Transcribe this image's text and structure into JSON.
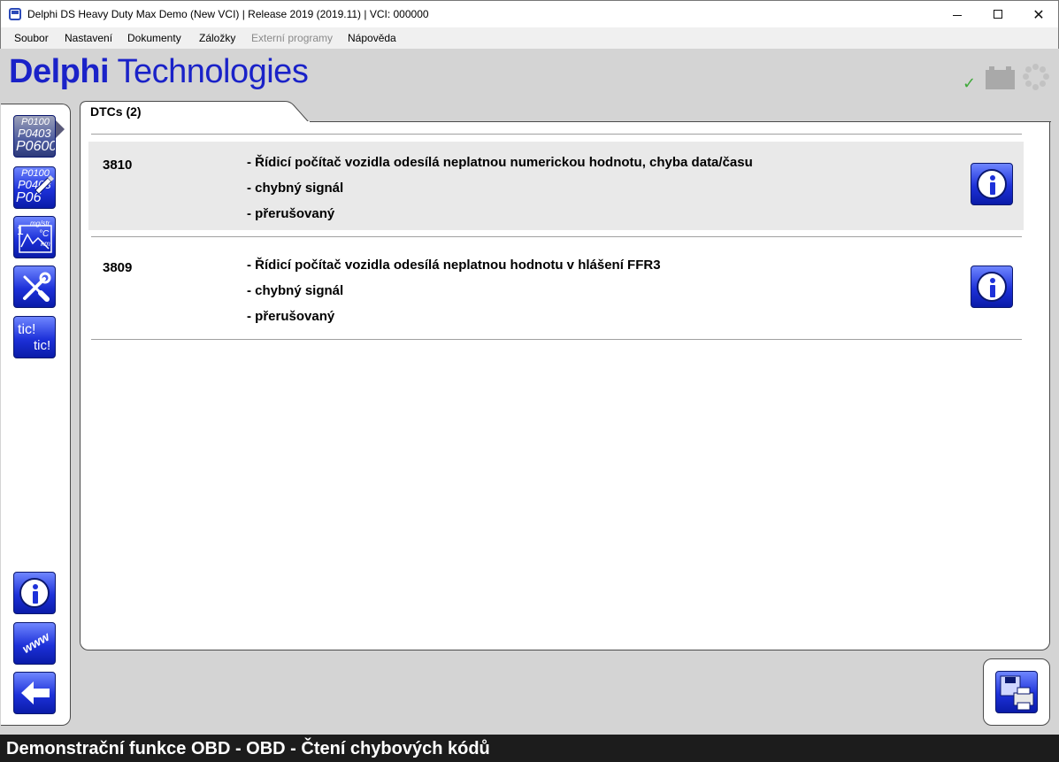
{
  "window": {
    "title": "Delphi DS Heavy Duty Max Demo (New VCI) | Release 2019 (2019.11)  |  VCI: 000000",
    "minimize_glyph": "",
    "maximize_glyph": "",
    "close_glyph": "✕"
  },
  "menu": {
    "items": [
      {
        "label": "Soubor",
        "enabled": true
      },
      {
        "label": "Nastavení",
        "enabled": true
      },
      {
        "label": "Dokumenty",
        "enabled": true
      },
      {
        "label": "Záložky",
        "enabled": true
      },
      {
        "label": "Externí programy",
        "enabled": false
      },
      {
        "label": "Nápověda",
        "enabled": true
      }
    ]
  },
  "logo": {
    "bold": "Delphi",
    "regular": " Technologies",
    "color": "#1a22c8"
  },
  "status_icons": {
    "check": "✓",
    "icons": [
      "check-icon",
      "battery-icon",
      "spinner-icon"
    ],
    "check_color": "#3fa93a"
  },
  "toolbar": {
    "tools": [
      {
        "name": "dtc-read-tool",
        "lines": [
          "P0100",
          "P0403",
          "P0600"
        ],
        "active": true
      },
      {
        "name": "dtc-clear-tool",
        "lines": [
          "P0100",
          "P0403",
          "P06"
        ]
      },
      {
        "name": "live-data-tool",
        "lines": [
          "mg/str",
          "°C",
          "km"
        ]
      },
      {
        "name": "service-functions-tool",
        "icon": "wrench-screwdriver-icon"
      },
      {
        "name": "tic-tic-tool",
        "lines": [
          "tic!",
          "tic!"
        ]
      },
      {
        "name": "info-tool",
        "icon": "info-icon"
      },
      {
        "name": "www-tool",
        "lines": [
          "www"
        ]
      },
      {
        "name": "back-tool",
        "icon": "back-arrow-icon"
      }
    ]
  },
  "tab": {
    "label": "DTCs (2)"
  },
  "dtcs": [
    {
      "code": "3810",
      "lines": [
        "- Řídicí počítač vozidla odesílá neplatnou numerickou hodnotu, chyba data/času",
        "- chybný signál",
        "- přerušovaný"
      ]
    },
    {
      "code": "3809",
      "lines": [
        "- Řídicí počítač vozidla odesílá neplatnou hodnotu v hlášení FFR3",
        "- chybný signál",
        "- přerušovaný"
      ]
    }
  ],
  "status_bar": {
    "text": "Demonstrační funkce OBD - OBD - Čtení chybových kódů"
  },
  "colors": {
    "accent_blue": "#1d31d9",
    "status_bar_bg": "#1c1c1c",
    "row_shade": "#e9e9e9"
  }
}
